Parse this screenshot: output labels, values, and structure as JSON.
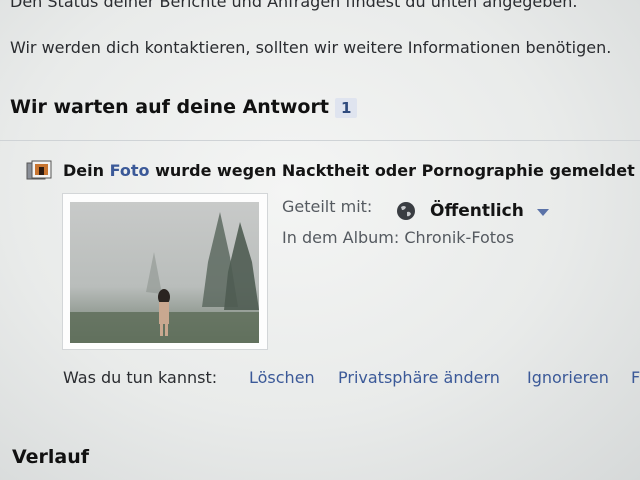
{
  "intro": {
    "status_line": "Den Status deiner Berichte und Anfragen findest du unten angegeben.",
    "contact_line": "Wir werden dich kontaktieren, sollten wir weitere Informationen benötigen."
  },
  "awaiting": {
    "title": "Wir warten auf deine Antwort",
    "count": "1"
  },
  "notification": {
    "icon": "photo-icon",
    "text_before": "Dein ",
    "link_text": "Foto",
    "text_after": " wurde wegen Nacktheit oder Pornographie gemeldet",
    "shared_label": "Geteilt mit:",
    "privacy_icon": "globe-icon",
    "privacy_value": "Öffentlich",
    "album_text": "In dem Album: Chronik-Fotos",
    "actions_label": "Was du tun kannst:",
    "actions": [
      "Löschen",
      "Privatsphäre ändern",
      "Ignorieren",
      "F"
    ]
  },
  "history": {
    "title": "Verlauf"
  },
  "colors": {
    "link": "#3b5998",
    "badge_bg": "#dfe4ef"
  }
}
